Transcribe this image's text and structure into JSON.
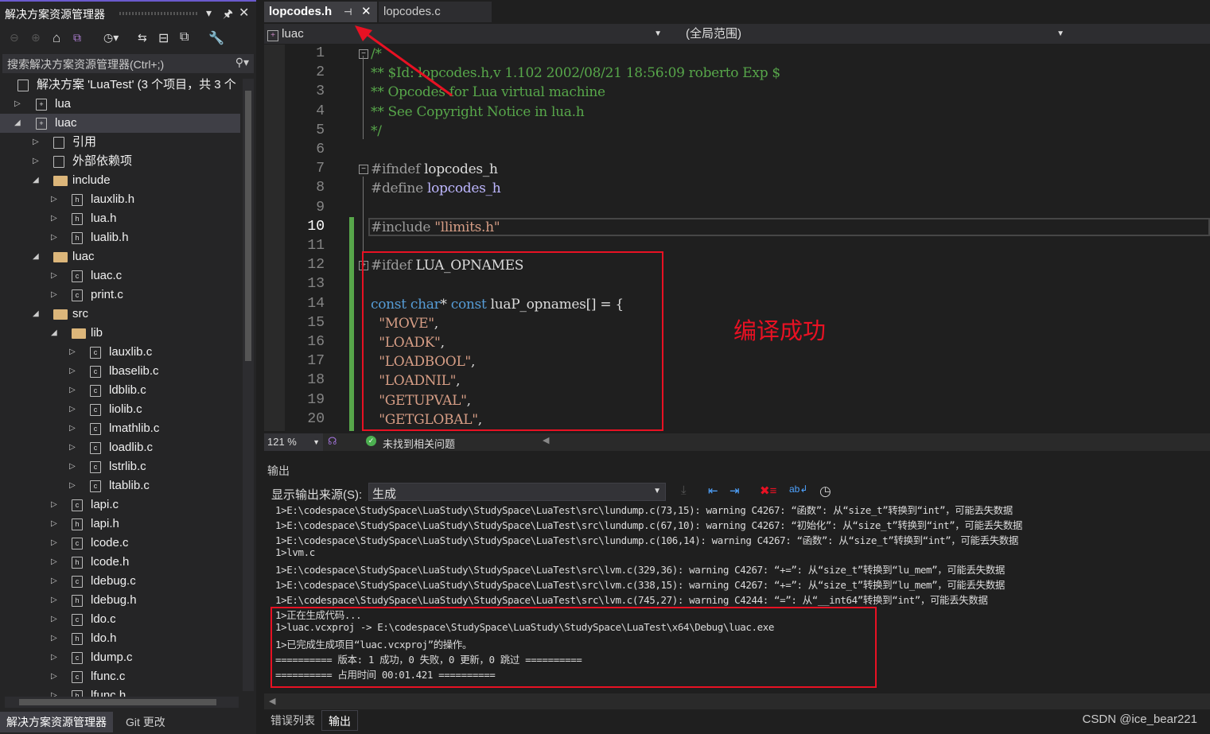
{
  "solution_explorer": {
    "title": "解决方案资源管理器",
    "search_placeholder": "搜索解决方案资源管理器(Ctrl+;)",
    "items": [
      {
        "label": "解决方案 'LuaTest' (3 个项目，共 3 个",
        "level": 0,
        "type": "solution",
        "expand": ""
      },
      {
        "label": "lua",
        "level": 0,
        "type": "project",
        "expand": "collapsed"
      },
      {
        "label": "luac",
        "level": 0,
        "type": "project",
        "expand": "expanded",
        "selected": true
      },
      {
        "label": "引用",
        "level": 1,
        "type": "ref",
        "expand": "collapsed"
      },
      {
        "label": "外部依赖项",
        "level": 1,
        "type": "ext",
        "expand": "collapsed"
      },
      {
        "label": "include",
        "level": 1,
        "type": "folder",
        "expand": "expanded"
      },
      {
        "label": "lauxlib.h",
        "level": 2,
        "type": "h",
        "expand": "collapsed"
      },
      {
        "label": "lua.h",
        "level": 2,
        "type": "h",
        "expand": "collapsed"
      },
      {
        "label": "lualib.h",
        "level": 2,
        "type": "h",
        "expand": "collapsed"
      },
      {
        "label": "luac",
        "level": 1,
        "type": "folder",
        "expand": "expanded"
      },
      {
        "label": "luac.c",
        "level": 2,
        "type": "c",
        "expand": "collapsed"
      },
      {
        "label": "print.c",
        "level": 2,
        "type": "c",
        "expand": "collapsed"
      },
      {
        "label": "src",
        "level": 1,
        "type": "folder",
        "expand": "expanded"
      },
      {
        "label": "lib",
        "level": 2,
        "type": "folder",
        "expand": "expanded"
      },
      {
        "label": "lauxlib.c",
        "level": 3,
        "type": "c",
        "expand": "collapsed"
      },
      {
        "label": "lbaselib.c",
        "level": 3,
        "type": "c",
        "expand": "collapsed"
      },
      {
        "label": "ldblib.c",
        "level": 3,
        "type": "c",
        "expand": "collapsed"
      },
      {
        "label": "liolib.c",
        "level": 3,
        "type": "c",
        "expand": "collapsed"
      },
      {
        "label": "lmathlib.c",
        "level": 3,
        "type": "c",
        "expand": "collapsed"
      },
      {
        "label": "loadlib.c",
        "level": 3,
        "type": "c",
        "expand": "collapsed"
      },
      {
        "label": "lstrlib.c",
        "level": 3,
        "type": "c",
        "expand": "collapsed"
      },
      {
        "label": "ltablib.c",
        "level": 3,
        "type": "c",
        "expand": "collapsed"
      },
      {
        "label": "lapi.c",
        "level": 2,
        "type": "c",
        "expand": "collapsed"
      },
      {
        "label": "lapi.h",
        "level": 2,
        "type": "h",
        "expand": "collapsed"
      },
      {
        "label": "lcode.c",
        "level": 2,
        "type": "c",
        "expand": "collapsed"
      },
      {
        "label": "lcode.h",
        "level": 2,
        "type": "h",
        "expand": "collapsed"
      },
      {
        "label": "ldebug.c",
        "level": 2,
        "type": "c",
        "expand": "collapsed"
      },
      {
        "label": "ldebug.h",
        "level": 2,
        "type": "h",
        "expand": "collapsed"
      },
      {
        "label": "ldo.c",
        "level": 2,
        "type": "c",
        "expand": "collapsed"
      },
      {
        "label": "ldo.h",
        "level": 2,
        "type": "h",
        "expand": "collapsed"
      },
      {
        "label": "ldump.c",
        "level": 2,
        "type": "c",
        "expand": "collapsed"
      },
      {
        "label": "lfunc.c",
        "level": 2,
        "type": "c",
        "expand": "collapsed"
      },
      {
        "label": "lfunc.h",
        "level": 2,
        "type": "h",
        "expand": "collapsed"
      }
    ],
    "bottom_tabs": [
      "解决方案资源管理器",
      "Git 更改"
    ]
  },
  "editor": {
    "tabs": [
      {
        "label": "lopcodes.h",
        "active": true
      },
      {
        "label": "lopcodes.c",
        "active": false
      }
    ],
    "project_selector": "luac",
    "scope_selector": "(全局范围)",
    "current_line": 10,
    "lines": [
      [
        [
          "cm",
          "/*"
        ]
      ],
      [
        [
          "cm",
          "** $Id: lopcodes.h,v 1.102 2002/08/21 18:56:09 roberto Exp $"
        ]
      ],
      [
        [
          "cm",
          "** Opcodes for Lua virtual machine"
        ]
      ],
      [
        [
          "cm",
          "** See Copyright Notice in lua.h"
        ]
      ],
      [
        [
          "cm",
          "*/"
        ]
      ],
      [],
      [
        [
          "pp",
          "#ifndef "
        ],
        [
          "id",
          "lopcodes_h"
        ]
      ],
      [
        [
          "pp",
          "#define "
        ],
        [
          "mc",
          "lopcodes_h"
        ]
      ],
      [],
      [
        [
          "pp",
          "#include "
        ],
        [
          "st",
          "\"llimits.h\""
        ]
      ],
      [],
      [
        [
          "pp",
          "#ifdef "
        ],
        [
          "id",
          "LUA_OPNAMES"
        ]
      ],
      [],
      [
        [
          "kw",
          "const "
        ],
        [
          "kw",
          "char"
        ],
        [
          "id",
          "* "
        ],
        [
          "kw",
          "const "
        ],
        [
          "id",
          "luaP_opnames[] = {"
        ]
      ],
      [
        [
          "st",
          "  \"MOVE\""
        ],
        [
          "id",
          ","
        ]
      ],
      [
        [
          "st",
          "  \"LOADK\""
        ],
        [
          "id",
          ","
        ]
      ],
      [
        [
          "st",
          "  \"LOADBOOL\""
        ],
        [
          "id",
          ","
        ]
      ],
      [
        [
          "st",
          "  \"LOADNIL\""
        ],
        [
          "id",
          ","
        ]
      ],
      [
        [
          "st",
          "  \"GETUPVAL\""
        ],
        [
          "id",
          ","
        ]
      ],
      [
        [
          "st",
          "  \"GETGLOBAL\""
        ],
        [
          "id",
          ","
        ]
      ]
    ],
    "annotation": "编译成功",
    "zoom": "121 %",
    "issues": "未找到相关问题"
  },
  "output": {
    "title": "输出",
    "source_label": "显示输出来源(S):",
    "source_value": "生成",
    "lines": [
      "1>E:\\codespace\\StudySpace\\LuaStudy\\StudySpace\\LuaTest\\src\\lundump.c(73,15): warning C4267: “函数”: 从“size_t”转换到“int”，可能丢失数据",
      "1>E:\\codespace\\StudySpace\\LuaStudy\\StudySpace\\LuaTest\\src\\lundump.c(67,10): warning C4267: “初始化”: 从“size_t”转换到“int”，可能丢失数据",
      "1>E:\\codespace\\StudySpace\\LuaStudy\\StudySpace\\LuaTest\\src\\lundump.c(106,14): warning C4267: “函数”: 从“size_t”转换到“int”，可能丢失数据",
      "1>lvm.c",
      "1>E:\\codespace\\StudySpace\\LuaStudy\\StudySpace\\LuaTest\\src\\lvm.c(329,36): warning C4267: “+=”: 从“size_t”转换到“lu_mem”，可能丢失数据",
      "1>E:\\codespace\\StudySpace\\LuaStudy\\StudySpace\\LuaTest\\src\\lvm.c(338,15): warning C4267: “+=”: 从“size_t”转换到“lu_mem”，可能丢失数据",
      "1>E:\\codespace\\StudySpace\\LuaStudy\\StudySpace\\LuaTest\\src\\lvm.c(745,27): warning C4244: “=”: 从“__int64”转换到“int”，可能丢失数据",
      "1>正在生成代码...",
      "1>luac.vcxproj -> E:\\codespace\\StudySpace\\LuaStudy\\StudySpace\\LuaTest\\x64\\Debug\\luac.exe",
      "1>已完成生成项目“luac.vcxproj”的操作。",
      "========== 版本: 1 成功，0 失败，0 更新，0 跳过 ==========",
      "========== 占用时间 00:01.421 =========="
    ],
    "bottom_tabs": [
      "错误列表",
      "输出"
    ]
  },
  "watermark": "CSDN @ice_bear221",
  "colors": {
    "accent": "#6a5acd",
    "annotation_red": "#e81123",
    "comment": "#57a64a",
    "keyword": "#569cd6",
    "string": "#d69d85",
    "change_bar": "#57a64a"
  }
}
